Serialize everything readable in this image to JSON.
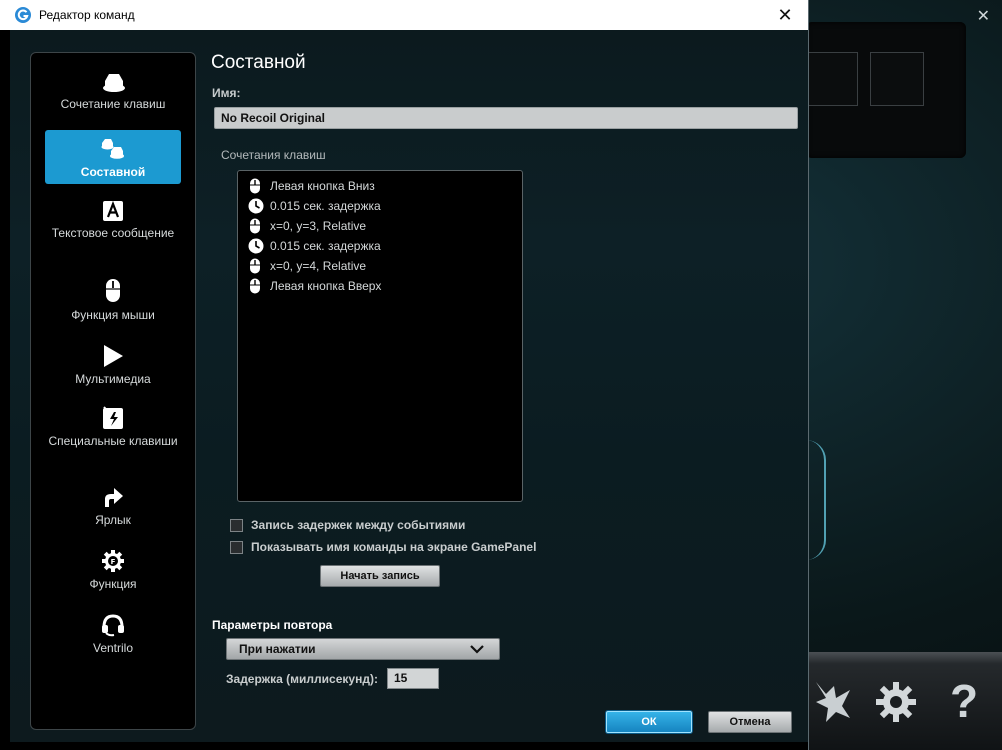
{
  "window": {
    "title": "Редактор команд"
  },
  "sidebar": {
    "items": [
      {
        "label": "Сочетание клавиш",
        "icon": "keys-icon"
      },
      {
        "label": "Составной",
        "icon": "multikey-icon",
        "active": true
      },
      {
        "label": "Текстовое сообщение",
        "icon": "text-a-icon"
      },
      {
        "label": "Функция мыши",
        "icon": "mouse-icon"
      },
      {
        "label": "Мультимедиа",
        "icon": "play-icon"
      },
      {
        "label": "Специальные клавиши",
        "icon": "special-key-icon"
      },
      {
        "label": "Ярлык",
        "icon": "shortcut-arrow-icon"
      },
      {
        "label": "Функция",
        "icon": "function-gear-icon"
      },
      {
        "label": "Ventrilo",
        "icon": "headset-icon"
      }
    ]
  },
  "main": {
    "heading": "Составной",
    "name_label": "Имя:",
    "name_value": "No Recoil Original",
    "sequence_label": "Сочетания клавиш",
    "sequence": [
      {
        "icon": "mouse-icon",
        "text": "Левая кнопка Вниз"
      },
      {
        "icon": "clock-icon",
        "text": "0.015 сек. задержка"
      },
      {
        "icon": "mouse-icon",
        "text": "x=0, y=3, Relative"
      },
      {
        "icon": "clock-icon",
        "text": "0.015 сек. задержка"
      },
      {
        "icon": "mouse-icon",
        "text": "x=0, y=4, Relative"
      },
      {
        "icon": "mouse-icon",
        "text": "Левая кнопка Вверх"
      }
    ],
    "record_delays_label": "Запись задержек между событиями",
    "show_name_label": "Показывать имя команды на экране GamePanel",
    "record_button": "Начать запись",
    "repeat_label": "Параметры повтора",
    "repeat_value": "При нажатии",
    "delay_label": "Задержка (миллисекунд):",
    "delay_value": "15",
    "ok_button": "ОК",
    "cancel_button": "Отмена"
  },
  "colors": {
    "accent": "#1c9ad1",
    "background": "#0d2026"
  }
}
